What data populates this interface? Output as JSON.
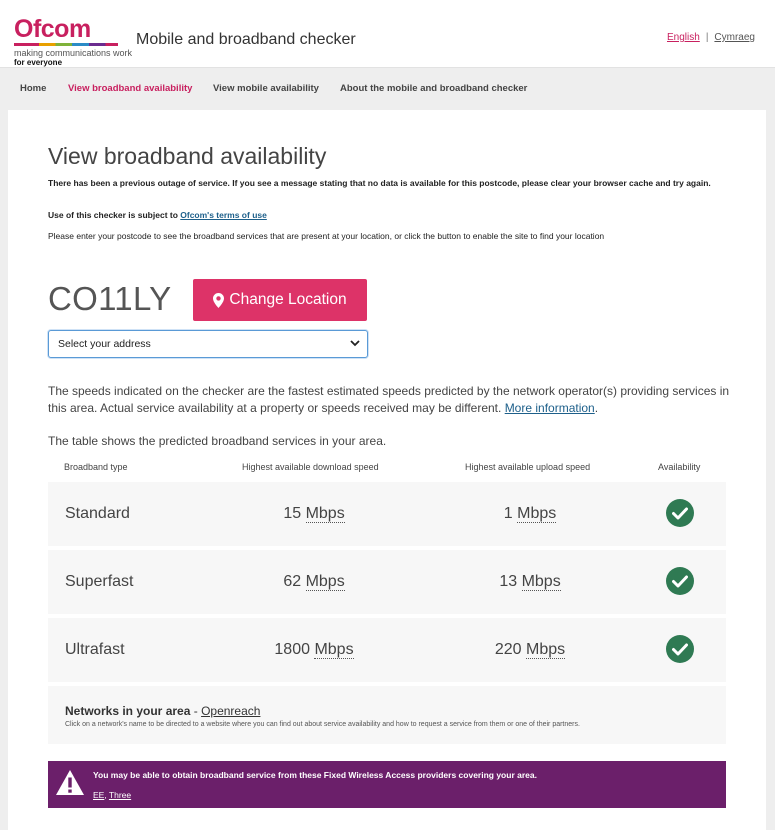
{
  "header": {
    "logo_text": "Ofcom",
    "logo_tagline": "making communications work",
    "logo_tagline2": "for everyone",
    "title": "Mobile and broadband checker",
    "lang_english": "English",
    "lang_separator": "|",
    "lang_welsh": "Cymraeg"
  },
  "nav": {
    "items": [
      {
        "label": "Home"
      },
      {
        "label": "View broadband availability"
      },
      {
        "label": "View mobile availability"
      },
      {
        "label": "About the mobile and broadband checker"
      }
    ],
    "active_index": 1
  },
  "main": {
    "heading": "View broadband availability",
    "outage_note": "There has been a previous outage of service. If you see a message stating that no data is available for this postcode, please clear your browser cache and try again.",
    "terms_prefix": "Use of this checker is subject to ",
    "terms_link": "Ofcom's terms of use",
    "instructions": "Please enter your postcode to see the broadband services that are present at your location, or click the button to enable the site to find your location",
    "postcode": "CO11LY",
    "change_location_label": "Change Location",
    "address_select": {
      "selected": "Select your address"
    },
    "speeds_note": "The speeds indicated on the checker are the fastest estimated speeds predicted by the network operator(s) providing services in this area. Actual service availability at a property or speeds received may be different. ",
    "more_info_link": "More information",
    "speeds_note_end": ".",
    "table_intro": "The table shows the predicted broadband services in your area."
  },
  "table": {
    "headers": {
      "type": "Broadband type",
      "download": "Highest available download speed",
      "upload": "Highest available upload speed",
      "availability": "Availability"
    },
    "rows": [
      {
        "type": "Standard",
        "download": "15",
        "download_unit": "Mbps",
        "upload": "1",
        "upload_unit": "Mbps",
        "available": true
      },
      {
        "type": "Superfast",
        "download": "62",
        "download_unit": "Mbps",
        "upload": "13",
        "upload_unit": "Mbps",
        "available": true
      },
      {
        "type": "Ultrafast",
        "download": "1800",
        "download_unit": "Mbps",
        "upload": "220",
        "upload_unit": "Mbps",
        "available": true
      }
    ]
  },
  "networks": {
    "title": "Networks in your area",
    "separator": " - ",
    "operator_link": "Openreach",
    "description": "Click on a network's name to be directed to a website where you can find out about service availability and how to request a service from them or one of their partners."
  },
  "fwa": {
    "message": "You may be able to obtain broadband service from these Fixed Wireless Access providers covering your area.",
    "providers": [
      "EE",
      "Three"
    ],
    "providers_separator": ", "
  },
  "colors": {
    "brand": "#c8205f",
    "button": "#dd3368",
    "available_check": "#2f7a53",
    "fwa_banner": "#6b1f6a",
    "link": "#1d5f8a"
  },
  "icons": {
    "location": "map-marker-icon",
    "available": "check-circle-icon",
    "warning": "warning-triangle-icon",
    "select_arrow": "chevron-down-icon"
  }
}
